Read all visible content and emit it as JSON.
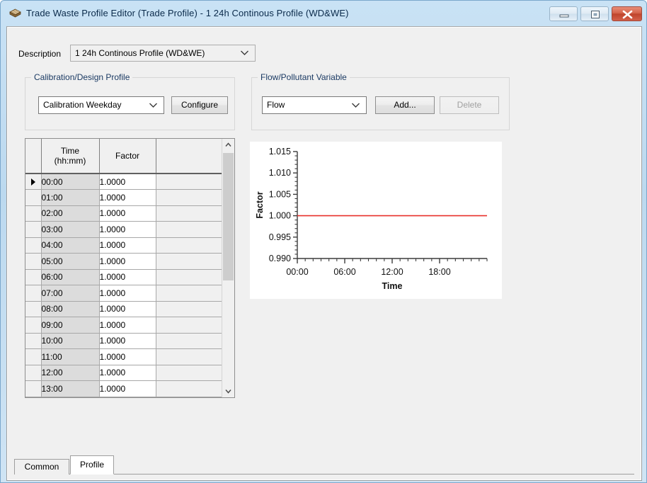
{
  "window": {
    "title": "Trade Waste Profile Editor (Trade Profile) - 1 24h Continous Profile (WD&WE)",
    "icon": "stacked-layers-icon",
    "controls": {
      "minimize": "minimize-icon",
      "maximize": "maximize-icon",
      "close": "close-icon"
    },
    "accent_border": "#7ba7cc",
    "client_background": "#f0f0f0"
  },
  "description": {
    "label": "Description",
    "value": "1 24h Continous Profile (WD&WE)"
  },
  "calibration_group": {
    "title": "Calibration/Design Profile",
    "profile_value": "Calibration Weekday",
    "configure_label": "Configure"
  },
  "flow_group": {
    "title": "Flow/Pollutant Variable",
    "variable_value": "Flow",
    "add_label": "Add...",
    "delete_label": "Delete",
    "delete_disabled": true
  },
  "grid": {
    "headers": {
      "selector": "",
      "time": "Time",
      "time_sub": "(hh:mm)",
      "factor": "Factor",
      "pad": ""
    },
    "selected_row_index": 0,
    "rows": [
      {
        "time": "00:00",
        "factor": "1.0000"
      },
      {
        "time": "01:00",
        "factor": "1.0000"
      },
      {
        "time": "02:00",
        "factor": "1.0000"
      },
      {
        "time": "03:00",
        "factor": "1.0000"
      },
      {
        "time": "04:00",
        "factor": "1.0000"
      },
      {
        "time": "05:00",
        "factor": "1.0000"
      },
      {
        "time": "06:00",
        "factor": "1.0000"
      },
      {
        "time": "07:00",
        "factor": "1.0000"
      },
      {
        "time": "08:00",
        "factor": "1.0000"
      },
      {
        "time": "09:00",
        "factor": "1.0000"
      },
      {
        "time": "10:00",
        "factor": "1.0000"
      },
      {
        "time": "11:00",
        "factor": "1.0000"
      },
      {
        "time": "12:00",
        "factor": "1.0000"
      },
      {
        "time": "13:00",
        "factor": "1.0000"
      }
    ],
    "scrollbar": {
      "up_icon": "chevron-up-icon",
      "down_icon": "chevron-down-icon",
      "thumb_position_pct": 6,
      "thumb_size_pct": 50
    }
  },
  "chart_data": {
    "type": "line",
    "title": "",
    "xlabel": "Time",
    "ylabel": "Factor",
    "ylim": [
      0.99,
      1.015
    ],
    "ytick_labels": [
      "0.990",
      "0.995",
      "1.000",
      "1.005",
      "1.010",
      "1.015"
    ],
    "ytick_values": [
      0.99,
      0.995,
      1.0,
      1.005,
      1.01,
      1.015
    ],
    "xtick_labels": [
      "00:00",
      "06:00",
      "12:00",
      "18:00"
    ],
    "xtick_values": [
      0,
      6,
      12,
      18
    ],
    "xlim": [
      0,
      24
    ],
    "grid": false,
    "legend": false,
    "series": [
      {
        "name": "Factor",
        "color": "#e8312a",
        "x": [
          0,
          1,
          2,
          3,
          4,
          5,
          6,
          7,
          8,
          9,
          10,
          11,
          12,
          13,
          14,
          15,
          16,
          17,
          18,
          19,
          20,
          21,
          22,
          23,
          24
        ],
        "values": [
          1.0,
          1.0,
          1.0,
          1.0,
          1.0,
          1.0,
          1.0,
          1.0,
          1.0,
          1.0,
          1.0,
          1.0,
          1.0,
          1.0,
          1.0,
          1.0,
          1.0,
          1.0,
          1.0,
          1.0,
          1.0,
          1.0,
          1.0,
          1.0,
          1.0
        ]
      }
    ]
  },
  "tabs": [
    {
      "label": "Common",
      "selected": false
    },
    {
      "label": "Profile",
      "selected": true
    }
  ]
}
